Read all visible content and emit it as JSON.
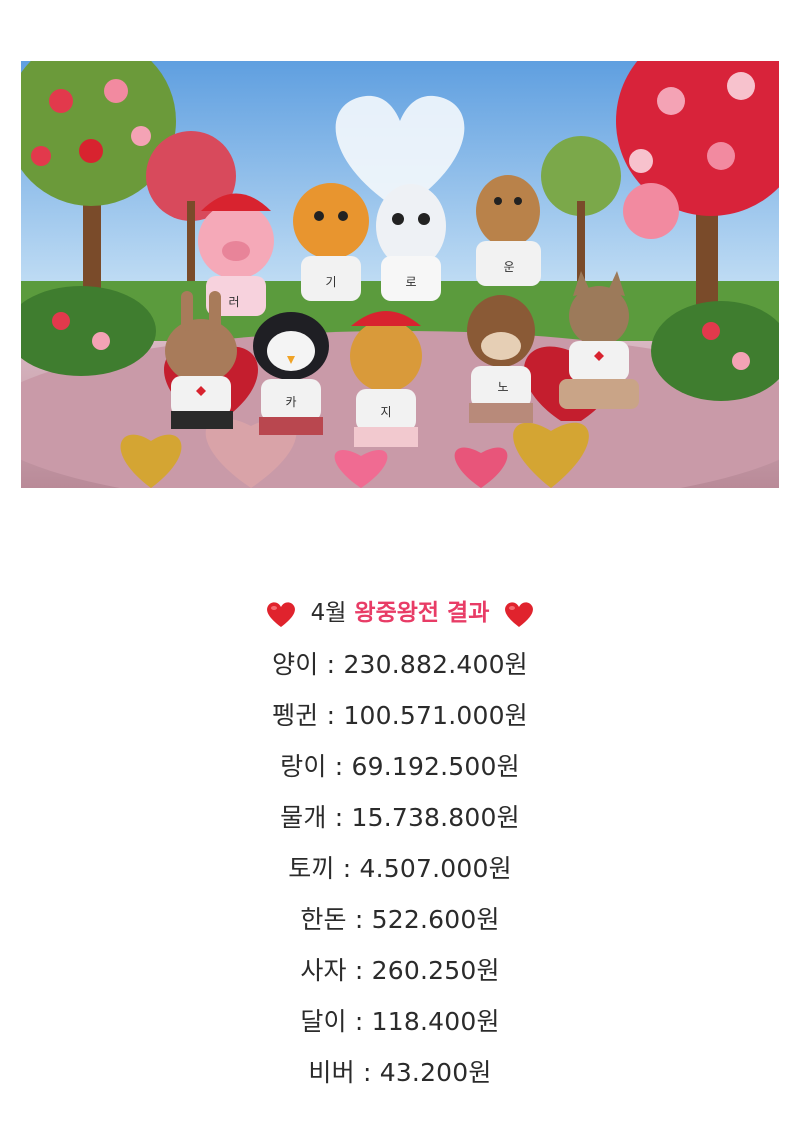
{
  "hero": {
    "image_icon": "valentine-animal-characters-illustration",
    "shirt_letters": [
      "러",
      "기",
      "로",
      "운",
      "카",
      "지",
      "노"
    ]
  },
  "title": {
    "heart_icon": "red-heart-icon",
    "heart_color": "#e0232d",
    "month": "4월",
    "event": "왕중왕전",
    "result": "결과",
    "accent_color": "#e83c66"
  },
  "separator": " : ",
  "results": [
    {
      "name": "양이",
      "amount": "230.882.400원"
    },
    {
      "name": "펭귄",
      "amount": "100.571.000원"
    },
    {
      "name": "랑이",
      "amount": "69.192.500원"
    },
    {
      "name": "물개",
      "amount": "15.738.800원"
    },
    {
      "name": "토끼",
      "amount": "4.507.000원"
    },
    {
      "name": "한돈",
      "amount": "522.600원"
    },
    {
      "name": "사자",
      "amount": "260.250원"
    },
    {
      "name": "달이",
      "amount": "118.400원"
    },
    {
      "name": "비버",
      "amount": "43.200원"
    }
  ]
}
